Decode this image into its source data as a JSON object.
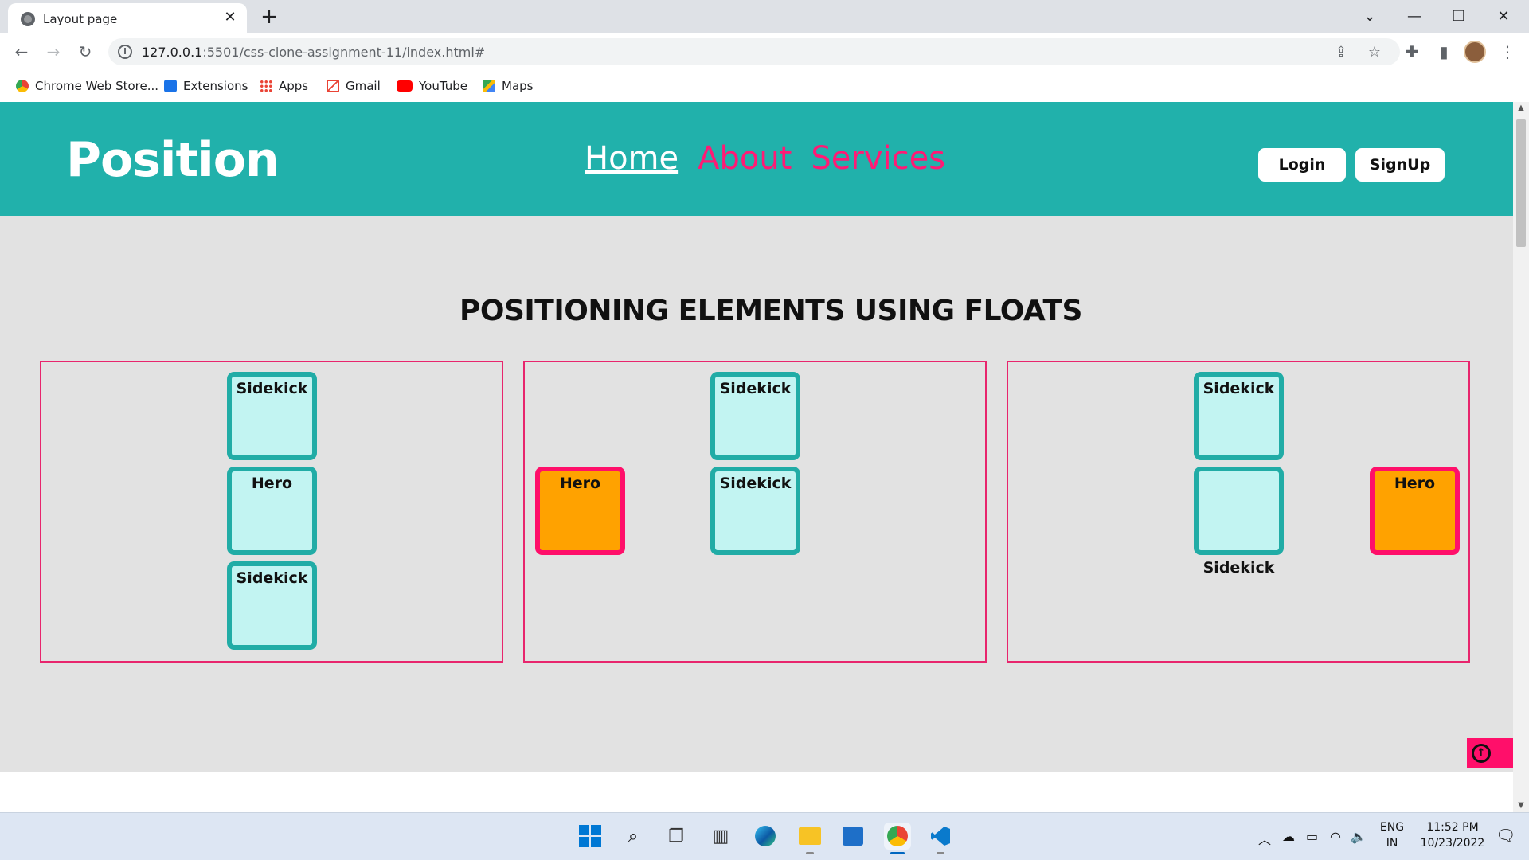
{
  "browser": {
    "tab_title": "Layout page",
    "url_host": "127.0.0.1",
    "url_path": ":5501/css-clone-assignment-11/index.html#",
    "bookmarks": [
      {
        "label": "Chrome Web Store...",
        "icon": "chrome-web-store-icon",
        "color": "#e8453c"
      },
      {
        "label": "Extensions",
        "icon": "puzzle-icon",
        "color": "#1a73e8"
      },
      {
        "label": "Apps",
        "icon": "apps-grid-icon",
        "color": "#ea4335"
      },
      {
        "label": "Gmail",
        "icon": "gmail-icon",
        "color": "#ea4335"
      },
      {
        "label": "YouTube",
        "icon": "youtube-icon",
        "color": "#ff0000"
      },
      {
        "label": "Maps",
        "icon": "maps-icon",
        "color": "#34a853"
      }
    ]
  },
  "site": {
    "logo": "Position",
    "nav": [
      {
        "label": "Home",
        "active": true
      },
      {
        "label": "About",
        "active": false
      },
      {
        "label": "Services",
        "active": false
      }
    ],
    "login_label": "Login",
    "signup_label": "SignUp",
    "section_title": "POSITIONING ELEMENTS USING FLOATS",
    "panels": [
      {
        "sidekick_top": "Sidekick",
        "hero": "Hero",
        "sidekick_bottom": "Sidekick"
      },
      {
        "sidekick_top": "Sidekick",
        "hero": "Hero",
        "sidekick_middle": "Sidekick"
      },
      {
        "sidekick_top": "Sidekick",
        "hero": "Hero",
        "sidekick_middle": "Sidekick"
      }
    ]
  },
  "taskbar": {
    "language_line1": "ENG",
    "language_line2": "IN",
    "time": "11:52 PM",
    "date": "10/23/2022"
  },
  "colors": {
    "header_teal": "#21b1ab",
    "accent_pink": "#ff1a75",
    "box_border_teal": "#21aca6",
    "box_fill_cyan": "#c2f4f2",
    "hero_fill_orange": "#ffa200",
    "panel_border": "#e8256d"
  }
}
